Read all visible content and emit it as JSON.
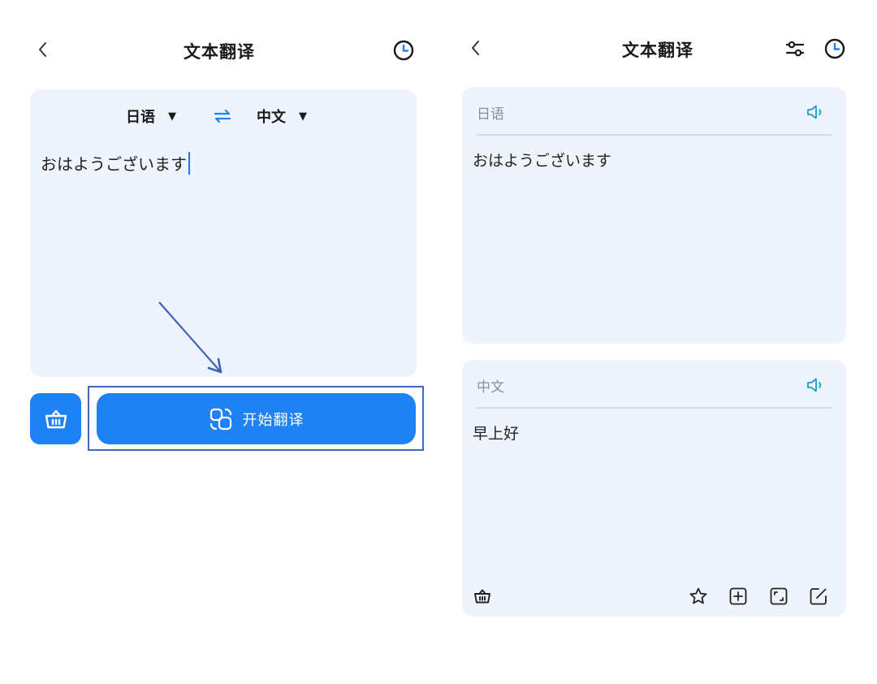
{
  "left": {
    "header": {
      "title": "文本翻译",
      "back_icon": "chevron-left-icon",
      "history_icon": "clock-icon"
    },
    "source_lang": "日语",
    "target_lang": "中文",
    "input_text": "おはようございます",
    "translate_button_label": "开始翻译",
    "icons": {
      "swap": "swap-icon",
      "clear": "basket-icon",
      "translate": "translate-icon"
    }
  },
  "right": {
    "header": {
      "title": "文本翻译",
      "back_icon": "chevron-left-icon",
      "settings_icon": "sliders-icon",
      "history_icon": "clock-icon"
    },
    "source_card": {
      "lang": "日语",
      "text": "おはようございます"
    },
    "result_card": {
      "lang": "中文",
      "text": "早上好"
    },
    "icons": [
      "basket-icon",
      "star-icon",
      "plus-square-icon",
      "fullscreen-icon",
      "edit-icon"
    ]
  },
  "colors": {
    "accent": "#1e82f5",
    "card_bg": "#eef3fc",
    "speaker": "#1aa0c8",
    "highlight": "#4169b8"
  }
}
